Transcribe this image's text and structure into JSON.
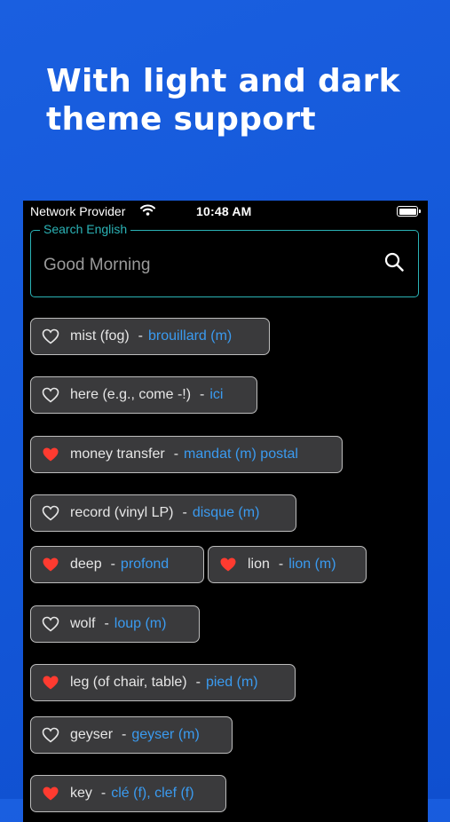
{
  "headline": {
    "line1": "With light and dark",
    "line2": "theme support"
  },
  "status_bar": {
    "carrier": "Network Provider",
    "time": "10:48 AM"
  },
  "search": {
    "label": "Search English",
    "value": "Good Morning"
  },
  "colors": {
    "accent": "#2bb3b6",
    "translation": "#3a9bf0",
    "favorite": "#ff3b30",
    "chip_bg": "#3a3a3c",
    "background": "#1357d8"
  },
  "separator": "-",
  "entries": [
    {
      "english": "mist (fog)",
      "french": "brouillard (m)",
      "favorite": false
    },
    {
      "english": "here (e.g., come -!)",
      "french": "ici",
      "favorite": false
    },
    {
      "english": "money transfer",
      "french": "mandat (m) postal",
      "favorite": true
    },
    {
      "english": "record (vinyl LP)",
      "french": "disque (m)",
      "favorite": false
    },
    {
      "english": "deep",
      "french": "profond",
      "favorite": true
    },
    {
      "english": "lion",
      "french": "lion (m)",
      "favorite": true
    },
    {
      "english": "wolf",
      "french": "loup (m)",
      "favorite": false
    },
    {
      "english": "leg (of chair, table)",
      "french": "pied (m)",
      "favorite": true
    },
    {
      "english": "geyser",
      "french": "geyser (m)",
      "favorite": false
    },
    {
      "english": "key",
      "french": "clé (f), clef (f)",
      "favorite": true
    }
  ]
}
